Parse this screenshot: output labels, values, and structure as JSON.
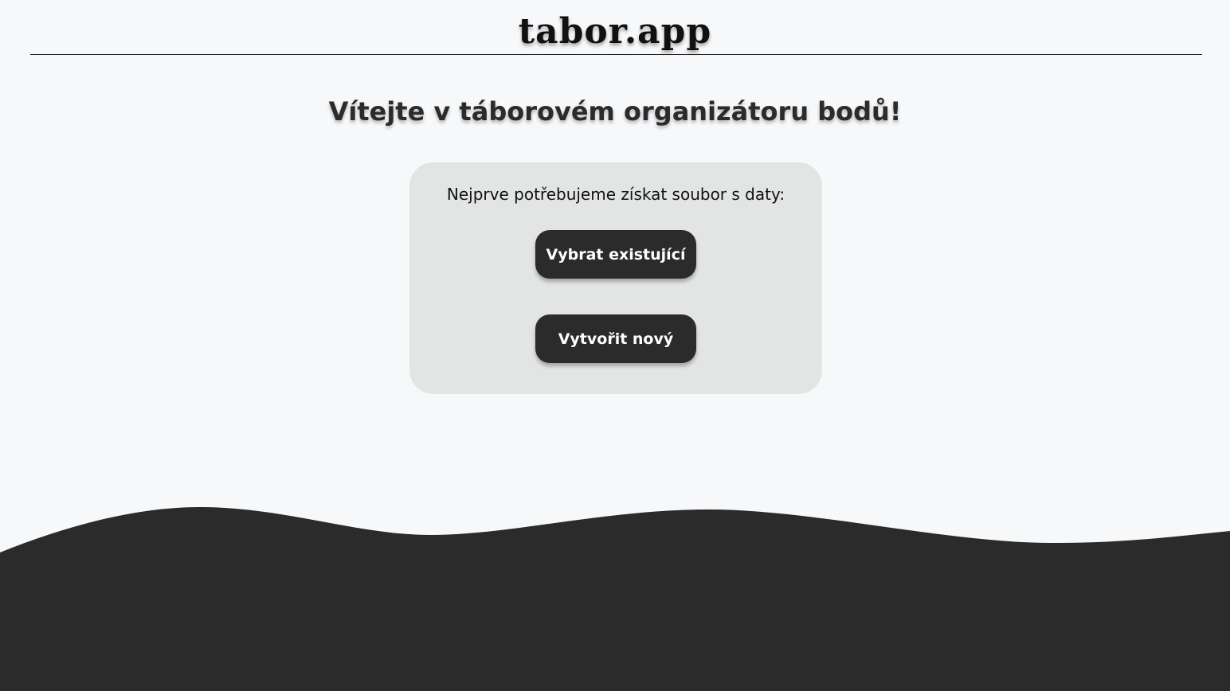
{
  "header": {
    "logo": "tabor.app"
  },
  "main": {
    "title": "Vítejte v táborovém organizátoru bodů!",
    "card": {
      "prompt": "Nejprve potřebujeme získat soubor s daty:",
      "select_existing_label": "Vybrat existující",
      "create_new_label": "Vytvořit nový"
    }
  },
  "colors": {
    "background": "#f7f8fa",
    "card": "#e3e5e4",
    "dark": "#2b2b2b",
    "button_text": "#ffffff"
  }
}
